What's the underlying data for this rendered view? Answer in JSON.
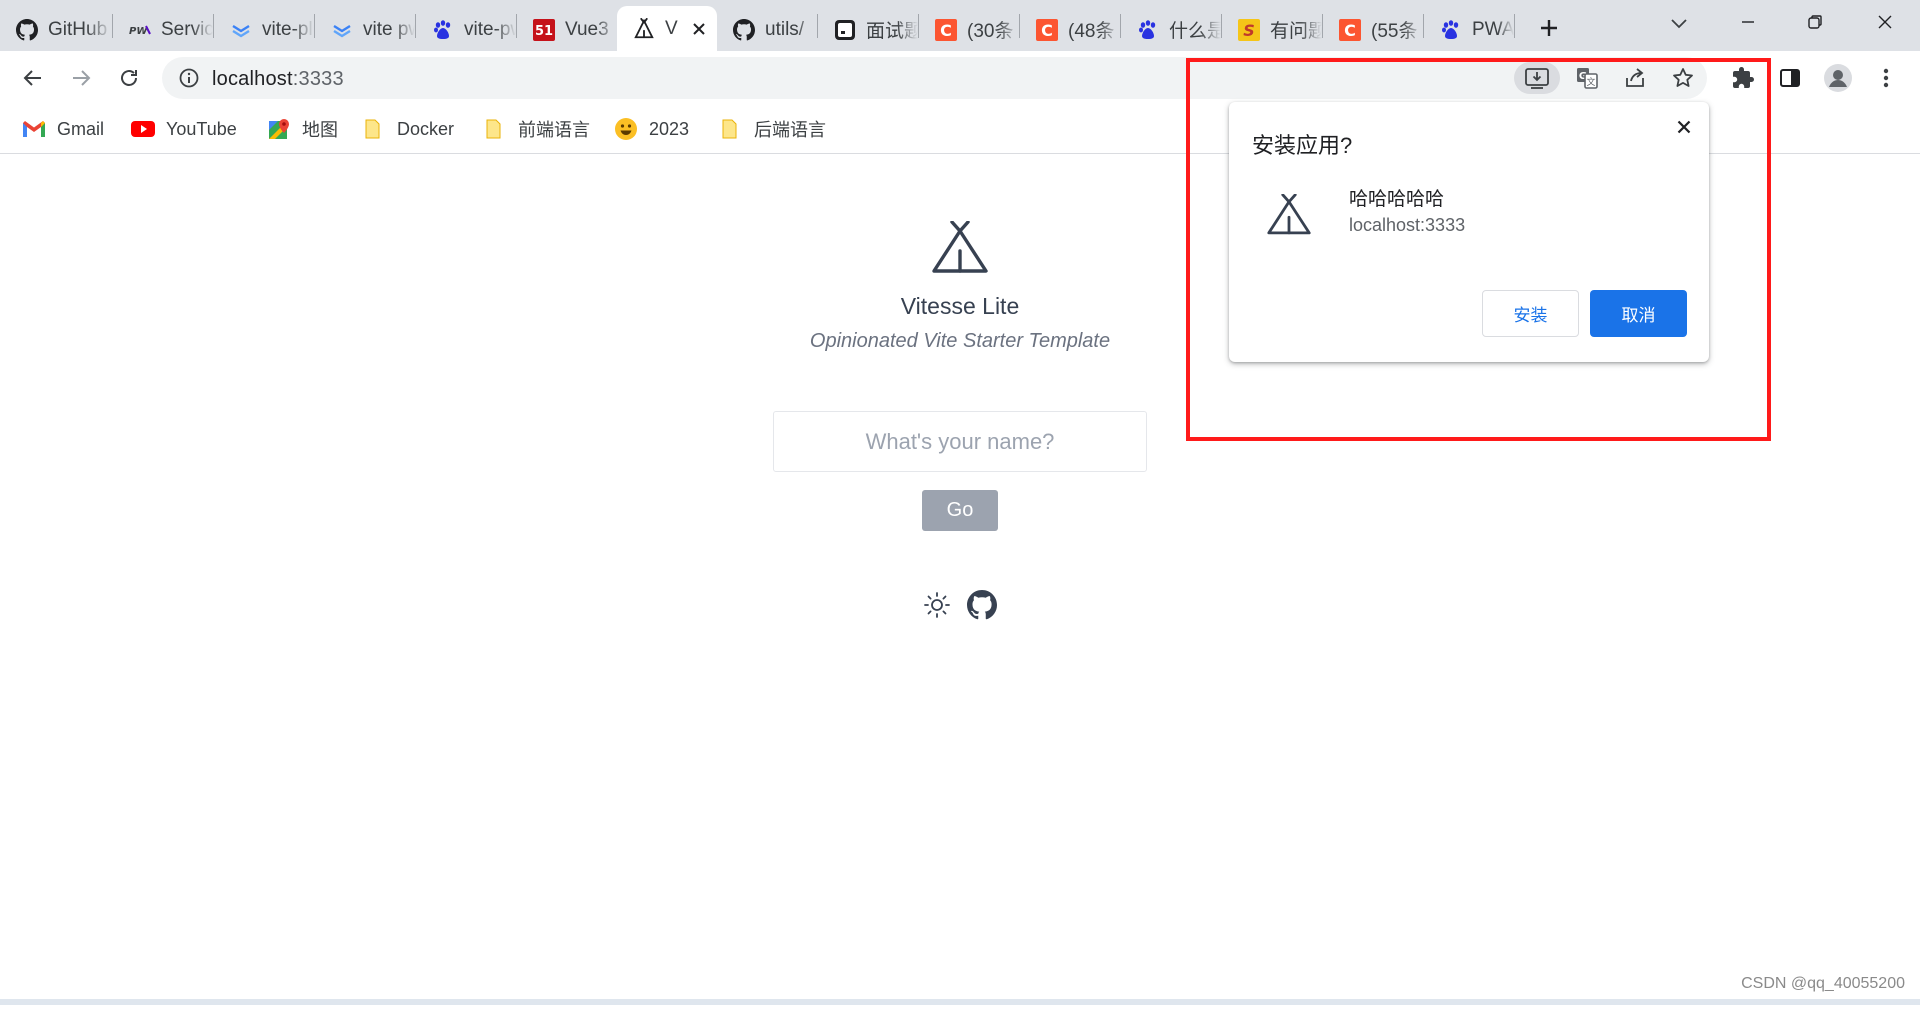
{
  "tabs": [
    {
      "title": "GitHub",
      "icon": "github-icon"
    },
    {
      "title": "Service Worker",
      "icon": "pwa-icon"
    },
    {
      "title": "vite-plugin-pwa",
      "icon": "vitepwa-icon"
    },
    {
      "title": "vite pwa",
      "icon": "vitepwa-icon"
    },
    {
      "title": "vite-pwa",
      "icon": "baidu-icon"
    },
    {
      "title": "Vue3",
      "icon": "51cto-icon"
    },
    {
      "title": "V",
      "icon": "vitesse-icon",
      "active": true
    },
    {
      "title": "utils/",
      "icon": "github-icon"
    },
    {
      "title": "面试题",
      "icon": "terminal-icon"
    },
    {
      "title": "(30条",
      "icon": "csdn-icon"
    },
    {
      "title": "(48条",
      "icon": "csdn-icon"
    },
    {
      "title": "什么是",
      "icon": "baidu-icon"
    },
    {
      "title": "有问题",
      "icon": "sogou-icon"
    },
    {
      "title": "(55条",
      "icon": "csdn-icon"
    },
    {
      "title": "PWA",
      "icon": "baidu-icon"
    }
  ],
  "address": {
    "host": "localhost",
    "port": ":3333"
  },
  "bookmarks": [
    {
      "label": "Gmail",
      "icon": "gmail-icon"
    },
    {
      "label": "YouTube",
      "icon": "youtube-icon"
    },
    {
      "label": "地图",
      "icon": "maps-icon"
    },
    {
      "label": "Docker",
      "icon": "folder-icon"
    },
    {
      "label": "前端语言",
      "icon": "folder-icon"
    },
    {
      "label": "2023",
      "icon": "smiley-icon"
    },
    {
      "label": "后端语言",
      "icon": "folder-icon"
    }
  ],
  "app": {
    "title": "Vitesse Lite",
    "tagline": "Opinionated Vite Starter Template",
    "name_placeholder": "What's your name?",
    "name_value": "",
    "go_label": "Go"
  },
  "install_dialog": {
    "title": "安装应用?",
    "app_name": "哈哈哈哈哈",
    "origin": "localhost:3333",
    "install_label": "安装",
    "cancel_label": "取消"
  },
  "watermark": "CSDN @qq_40055200",
  "colors": {
    "accent": "#1a73e8",
    "highlight": "#ff1a1a",
    "tabstrip": "#dee1e6",
    "go_button": "#9ca3af"
  }
}
